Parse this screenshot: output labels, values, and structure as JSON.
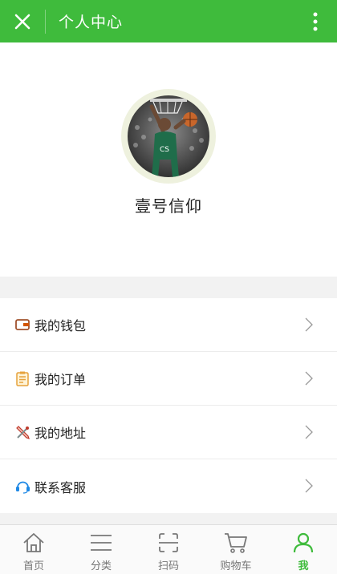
{
  "header": {
    "title": "个人中心",
    "close_icon": "close-icon",
    "more_icon": "more-vertical-icon",
    "background_color": "#3fbb3c"
  },
  "profile": {
    "username": "壹号信仰",
    "avatar": "basketball-player-avatar"
  },
  "menu": {
    "items": [
      {
        "label": "我的钱包",
        "icon": "wallet-icon",
        "icon_color": "#a0522d"
      },
      {
        "label": "我的订单",
        "icon": "order-icon",
        "icon_color": "#e6a23c"
      },
      {
        "label": "我的地址",
        "icon": "address-icon",
        "icon_color": "#c0392b"
      },
      {
        "label": "联系客服",
        "icon": "customer-service-icon",
        "icon_color": "#1e88e5"
      }
    ]
  },
  "tabbar": {
    "active_color": "#3fbb3c",
    "items": [
      {
        "label": "首页",
        "icon": "home-icon",
        "active": false
      },
      {
        "label": "分类",
        "icon": "category-icon",
        "active": false
      },
      {
        "label": "扫码",
        "icon": "scan-icon",
        "active": false
      },
      {
        "label": "购物车",
        "icon": "cart-icon",
        "active": false
      },
      {
        "label": "我",
        "icon": "user-icon",
        "active": true
      }
    ]
  }
}
